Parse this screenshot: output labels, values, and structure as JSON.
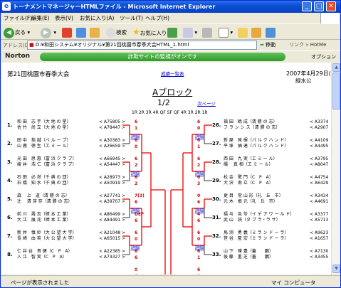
{
  "window": {
    "title": "トーナメントマネージャーHTMLファイル - Microsoft Internet Explorer"
  },
  "menu": [
    "ファイル(F)",
    "編集(E)",
    "表示(V)",
    "お気に入り(A)",
    "ツール(T)",
    "ヘルプ(H)"
  ],
  "toolbar": {
    "back": "戻る",
    "search": "検索",
    "favorites": "お気に入り"
  },
  "address": {
    "label": "アドレス(D)",
    "url": "D:¥和田システム¥オリジナル¥第21回桃園市春季大会HTML_1.html",
    "go": "移動",
    "links": "リンク",
    "hotmail": "HotMe"
  },
  "norton": {
    "brand": "Norton",
    "message": "詐欺サイトの監視がオンです",
    "options": "オプション"
  },
  "status": {
    "text": "ページが表示されました",
    "zone": "マイ コンピュータ"
  },
  "page": {
    "tournament": "第21回桃園市春季大会",
    "results_link": "成績一覧表",
    "date": "2007年4月29日(",
    "venue": "緑水公",
    "block": "Aブロック",
    "page_no": "1/2",
    "next_link": "次ページ",
    "rounds": "1R 2R 3R 4R QF SF QF 4R 3R 2R 1R"
  },
  "left_entries": [
    {
      "seed": "1.",
      "l1": "和 田　志 芋（大 地 の 星）",
      "l2": "佐 竹　尚 立（大 地 の 星）",
      "c1": "< A75805 >",
      "c2": "< A78447 >"
    },
    {
      "seed": "2.",
      "l1": "田 中　指 誠（ベ ル ー プ）",
      "l2": "山 鹿　徳 生（エ ミ ー ル）",
      "c1": "< A30383 >",
      "c2": "< A26659 >"
    },
    {
      "seed": "3.",
      "l1": "光 田　思 惠（富 浜 ク ラ ブ）",
      "l2": "綾 井　浩 仁（富 浜 ク ラ ブ）",
      "c1": "< A66945 >",
      "c2": "< A54447 >"
    },
    {
      "seed": "4.",
      "l1": "石 田　必 然（千 典 の 団）",
      "l2": "石 橋　知 水（千 典 の 団）",
      "c1": "< A28973 >",
      "c2": "< A50919 >"
    },
    {
      "seed": "5.",
      "l1": "森 　上　道（清 勝 の 志）",
      "l2": "辻 　清 芽 存（清 勝 の 志）",
      "c1": "< A27741 >",
      "c2": "< A39707 >"
    },
    {
      "seed": "6.",
      "l1": "前 川　壽 志（樟 本 工 業）",
      "l2": "大 江　展 兆（樟 本 工 業）",
      "c1": "< A86499 >",
      "c2": "< A84491 >"
    },
    {
      "seed": "7.",
      "l1": "新 井　慎 紗（大 公 望 大 学）",
      "l2": "長 崎　由 英（大 公 望 大 学）",
      "c1": "< A21048 >",
      "c2": "< A65015 >"
    },
    {
      "seed": "8.",
      "l1": "仁 井 谷　貴 健（C　P　A）",
      "l2": "入 江　智 実（C　P　A）",
      "c1": "< A22385 >",
      "c2": "< A73327 >"
    }
  ],
  "right_entries": [
    {
      "seed": "26.",
      "l1": "福 田　暁 成（清 勝 の 志）",
      "l2": "フ ラ ン シ ス（清 勝 の 志）",
      "c1": "< A3374",
      "c2": "< A2907"
    },
    {
      "seed": "27.",
      "l1": "新 屋　発 揮（パ ル ク ハ ン ド）",
      "l2": "平 塚　抽 達（パ ル ク ハ ン ド）",
      "c1": "< A4109",
      "c2": "< A4495"
    },
    {
      "seed": "28.",
      "l1": "西 田　九 実（エ ミ ー ル）",
      "l2": "縄 　真 相（エ ミ ー ル）",
      "c1": "< A3795",
      "c2": "< A8047"
    },
    {
      "seed": "29.",
      "l1": "松 金　驚 門（C　P　A）",
      "l2": "大 沢　南 立（C　P　A）",
      "c1": "< A4754",
      "c2": "< A6429"
    },
    {
      "seed": "30.",
      "l1": "更 目　常 山 形（礼　丘　市）",
      "l2": "元 木　根 元（礼　丘　市）",
      "c1": "< A3434",
      "c2": "< A4691"
    },
    {
      "seed": "31.",
      "l1": "福 与　色 苓（イ デ ア ワ ー ル ド）",
      "l2": "武 山　読（タ ブ ラ・ラ サ）",
      "c1": "< A3377",
      "c2": "< A5713"
    },
    {
      "seed": "32.",
      "l1": "馬 渕　勇 義（ミ ラ ン ド ー ラ）",
      "l2": "笹 谷　藍 宏（ミ ラ ン ド ー ラ）",
      "c1": "< A9623",
      "c2": "< A1657"
    },
    {
      "seed": "33.",
      "l1": "山 下　陳 豊（蓋　　鵬）",
      "l2": "後 藤　重 芝（蓋　　鵬）",
      "c1": "< A7130",
      "c2": "< A3455"
    }
  ],
  "left_scores": [
    "6",
    "1",
    "6",
    "0",
    "6",
    "2",
    "6",
    "2",
    "7(3)",
    "6",
    "DEF",
    "6",
    "6",
    "0",
    "6",
    "6",
    "0",
    "6"
  ],
  "right_scores": [
    "6",
    "0",
    "6",
    "1",
    "6",
    "2",
    "6",
    "3",
    "0",
    "6",
    "4",
    "6",
    "6",
    "0",
    "6",
    "1",
    "6",
    "2"
  ],
  "detail_label": "詳細"
}
